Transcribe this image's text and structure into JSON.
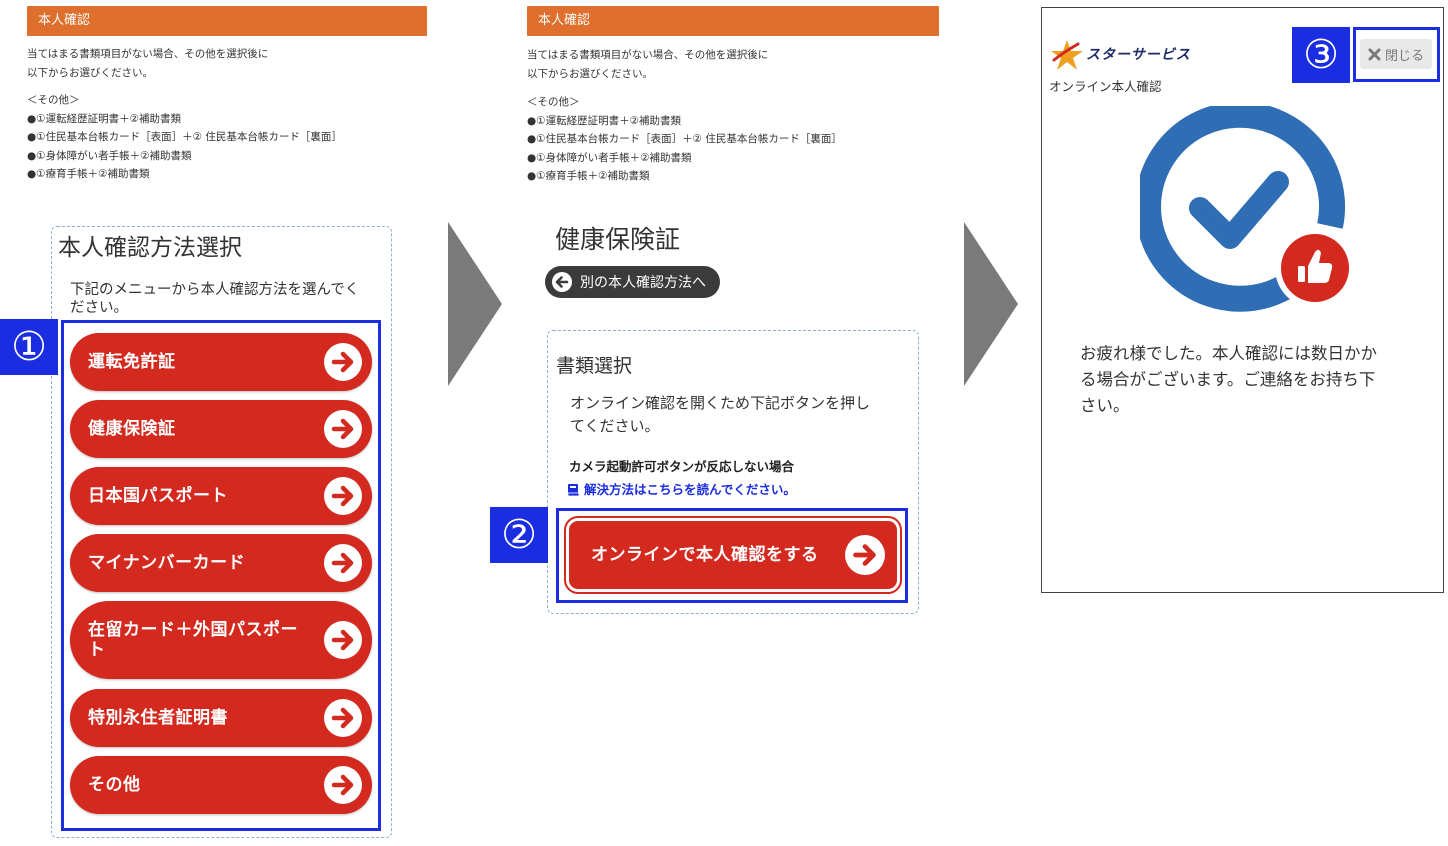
{
  "panel1": {
    "header": "本人確認",
    "intro_lines": [
      "当てはまる書類項目がない場合、その他を選択後に",
      "以下からお選びください。"
    ],
    "other_heading": "＜その他＞",
    "other_items": [
      "●①運転経歴証明書＋②補助書類",
      "●①住民基本台帳カード［表面］＋② 住民基本台帳カード［裏面］",
      "●①身体障がい者手帳＋②補助書類",
      "●①療育手帳＋②補助書類"
    ],
    "box_title": "本人確認方法選択",
    "box_desc_lines": [
      "下記のメニューから本人確認方法を選んでく",
      "ださい。"
    ],
    "buttons": [
      {
        "label": "運転免許証"
      },
      {
        "label": "健康保険証"
      },
      {
        "label": "日本国パスポート"
      },
      {
        "label": "マイナンバーカード"
      },
      {
        "label": "在留カード＋外国パスポート"
      },
      {
        "label": "特別永住者証明書"
      },
      {
        "label": "その他"
      }
    ],
    "badge": "①"
  },
  "panel2": {
    "header": "本人確認",
    "intro_lines": [
      "当てはまる書類項目がない場合、その他を選択後に",
      "以下からお選びください。"
    ],
    "other_heading": "＜その他＞",
    "other_items": [
      "●①運転経歴証明書＋②補助書類",
      "●①住民基本台帳カード［表面］＋② 住民基本台帳カード［裏面］",
      "●①身体障がい者手帳＋②補助書類",
      "●①療育手帳＋②補助書類"
    ],
    "doc_title": "健康保険証",
    "back_label": "別の本人確認方法へ",
    "box_title": "書類選択",
    "box_desc_lines": [
      "オンライン確認を開くため下記ボタンを押し",
      "てください。"
    ],
    "camera_note": "カメラ起動許可ボタンが反応しない場合",
    "help_link": "解決方法はこちらを読んでください。",
    "online_button": "オンラインで本人確認をする",
    "badge": "②"
  },
  "panel3": {
    "brand": "スターサービス",
    "subtitle": "オンライン本人確認",
    "close_label": "閉じる",
    "message_lines": [
      "お疲れ様でした。本人確認には数日かか",
      "る場合がございます。ご連絡をお持ち下",
      "さい。"
    ],
    "badge": "③"
  },
  "colors": {
    "header_orange": "#de6f2c",
    "button_red": "#d3291f",
    "frame_blue": "#1a2de0",
    "check_blue": "#2f6db5",
    "link_blue": "#1a2de0",
    "chevron_gray": "#7a7a7a"
  },
  "icons": {
    "button_arrow": "arrow-right-circle-icon",
    "back_arrow": "arrow-left-circle-icon",
    "help": "book-icon",
    "close": "x-icon",
    "complete": "check-circle-icon",
    "thumbs": "thumbs-up-icon",
    "logo": "star-logo-icon"
  }
}
